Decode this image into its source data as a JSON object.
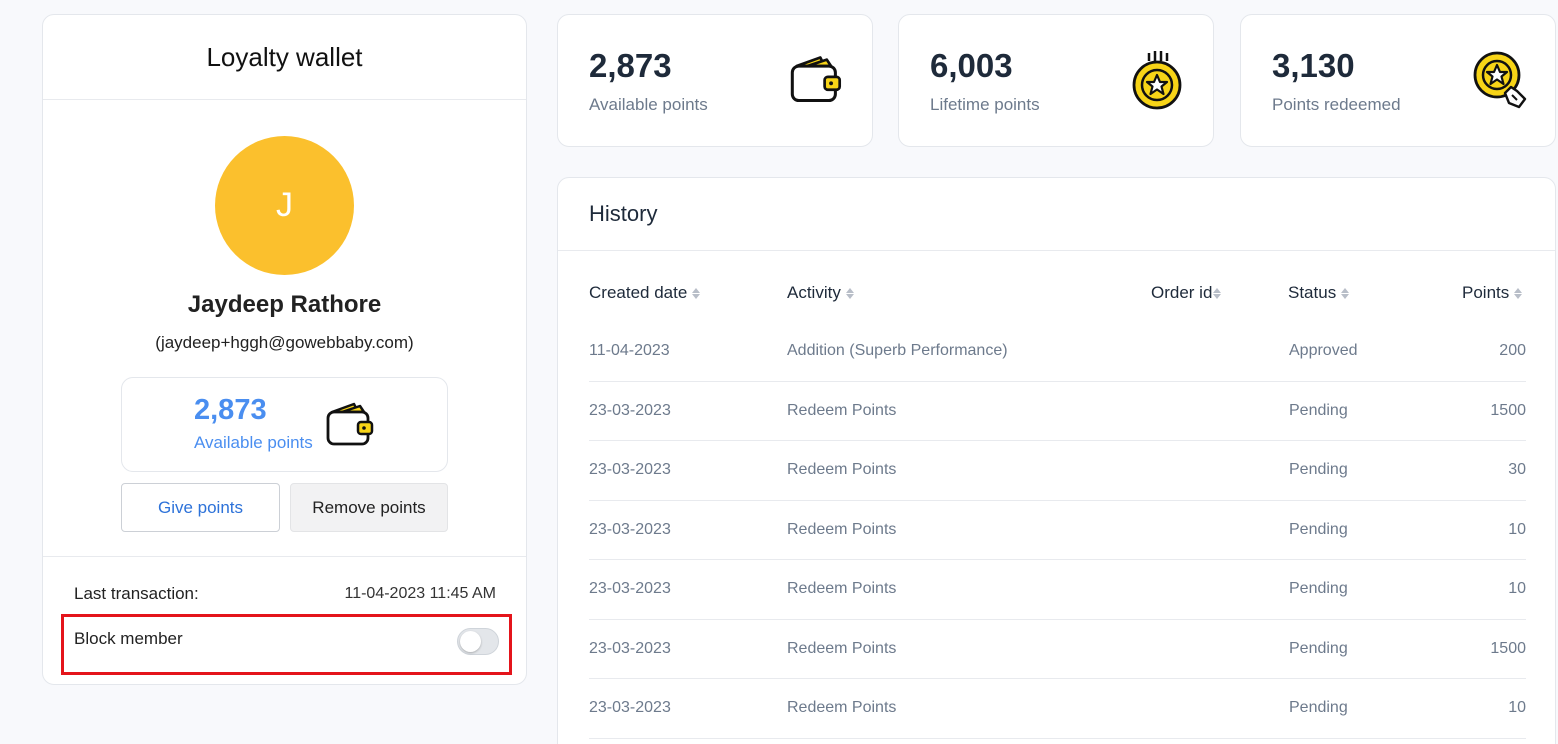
{
  "wallet": {
    "title": "Loyalty wallet",
    "avatar_initial": "J",
    "name": "Jaydeep Rathore",
    "email": "(jaydeep+hggh@gowebbaby.com)",
    "available_points": "2,873",
    "available_label": "Available points",
    "give_label": "Give points",
    "remove_label": "Remove points",
    "last_tx_label": "Last transaction:",
    "last_tx_value": "11-04-2023 11:45 AM",
    "block_label": "Block member",
    "block_enabled": false
  },
  "stats": [
    {
      "value": "2,873",
      "label": "Available points",
      "icon": "wallet-icon"
    },
    {
      "value": "6,003",
      "label": "Lifetime points",
      "icon": "star-coin-icon"
    },
    {
      "value": "3,130",
      "label": "Points redeemed",
      "icon": "redeem-coin-icon"
    }
  ],
  "history": {
    "title": "History",
    "columns": [
      "Created date",
      "Activity",
      "Order id",
      "Status",
      "Points"
    ],
    "rows": [
      {
        "date": "11-04-2023",
        "activity": "Addition (Superb Performance)",
        "order": "",
        "status": "Approved",
        "points": "200"
      },
      {
        "date": "23-03-2023",
        "activity": "Redeem Points",
        "order": "",
        "status": "Pending",
        "points": "1500"
      },
      {
        "date": "23-03-2023",
        "activity": "Redeem Points",
        "order": "",
        "status": "Pending",
        "points": "30"
      },
      {
        "date": "23-03-2023",
        "activity": "Redeem Points",
        "order": "",
        "status": "Pending",
        "points": "10"
      },
      {
        "date": "23-03-2023",
        "activity": "Redeem Points",
        "order": "",
        "status": "Pending",
        "points": "10"
      },
      {
        "date": "23-03-2023",
        "activity": "Redeem Points",
        "order": "",
        "status": "Pending",
        "points": "1500"
      },
      {
        "date": "23-03-2023",
        "activity": "Redeem Points",
        "order": "",
        "status": "Pending",
        "points": "10"
      }
    ]
  },
  "colors": {
    "accent_blue": "#4a8ef0",
    "avatar_yellow": "#fbc02d",
    "highlight_red": "#e4141b",
    "icon_yellow": "#f7d417"
  }
}
